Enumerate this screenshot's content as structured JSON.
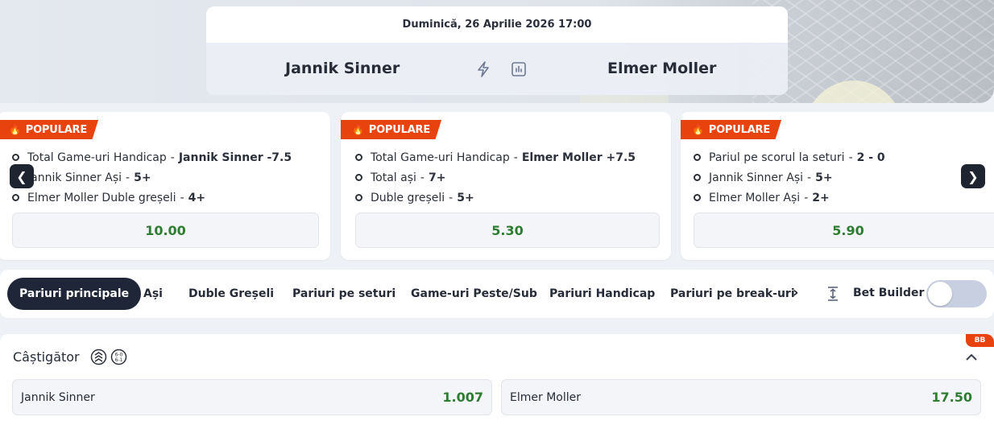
{
  "header": {
    "date": "Duminică, 26 Aprilie 2026 17:00",
    "home_team": "Jannik Sinner",
    "away_team": "Elmer Moller",
    "icons": [
      "bolt-icon",
      "stats-icon"
    ]
  },
  "popular": {
    "tag_label": "POPULARE",
    "cards": [
      {
        "legs": [
          {
            "market": "Total Game-uri Handicap",
            "value": "Jannik Sinner -7.5"
          },
          {
            "market": "Jannik Sinner Ași",
            "value": "5+"
          },
          {
            "market": "Elmer Moller Duble greșeli",
            "value": "4+"
          }
        ],
        "odds": "10.00"
      },
      {
        "legs": [
          {
            "market": "Total Game-uri Handicap",
            "value": "Elmer Moller +7.5"
          },
          {
            "market": "Total ași",
            "value": "7+"
          },
          {
            "market": "Duble greșeli",
            "value": "5+"
          }
        ],
        "odds": "5.30"
      },
      {
        "legs": [
          {
            "market": "Pariul pe scorul la seturi",
            "value": "2 - 0"
          },
          {
            "market": "Jannik Sinner Ași",
            "value": "5+"
          },
          {
            "market": "Elmer Moller Ași",
            "value": "2+"
          }
        ],
        "odds": "5.90"
      }
    ]
  },
  "tabs": {
    "items": [
      "Pariuri principale",
      "Ași",
      "Duble Greșeli",
      "Pariuri pe seturi",
      "Game-uri Peste/Sub",
      "Pariuri Handicap",
      "Pariuri pe break-uri"
    ],
    "active": "Pariuri principale",
    "bet_builder_label": "Bet Builder",
    "bet_builder_enabled": false
  },
  "market": {
    "title": "Câștigător",
    "badge": "BB",
    "selections": [
      {
        "name": "Jannik Sinner",
        "odds": "1.007"
      },
      {
        "name": "Elmer Moller",
        "odds": "17.50"
      }
    ]
  },
  "colors": {
    "accent": "#e8430f",
    "odds_green": "#2e7d32",
    "dark": "#1e2638"
  }
}
